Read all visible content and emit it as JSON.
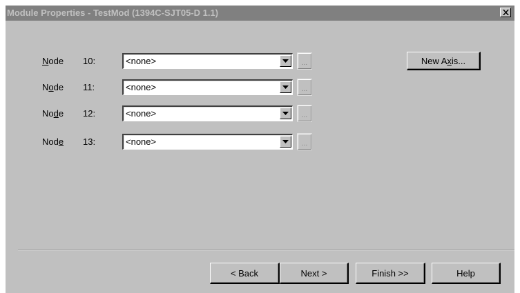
{
  "window": {
    "title": "Module Properties - TestMod (1394C-SJT05-D 1.1)",
    "close_icon": "close-x-icon"
  },
  "nodes": [
    {
      "label_prefix": "",
      "label_key": "N",
      "label_suffix": "ode",
      "number": "10:",
      "value": "<none>",
      "ellipsis": "..."
    },
    {
      "label_prefix": "N",
      "label_key": "o",
      "label_suffix": "de",
      "number": "11:",
      "value": "<none>",
      "ellipsis": "..."
    },
    {
      "label_prefix": "No",
      "label_key": "d",
      "label_suffix": "e",
      "number": "12:",
      "value": "<none>",
      "ellipsis": "..."
    },
    {
      "label_prefix": "Nod",
      "label_key": "e",
      "label_suffix": "",
      "number": "13:",
      "value": "<none>",
      "ellipsis": "..."
    }
  ],
  "new_axis": {
    "prefix": "New A",
    "key": "x",
    "suffix": "is..."
  },
  "footer": {
    "back": "< Back",
    "next": "Next >",
    "finish": "Finish >>",
    "help": "Help"
  },
  "colors": {
    "dialog_face": "#c0c0c0",
    "titlebar_inactive": "#808080",
    "title_text": "#c0c0c0"
  }
}
